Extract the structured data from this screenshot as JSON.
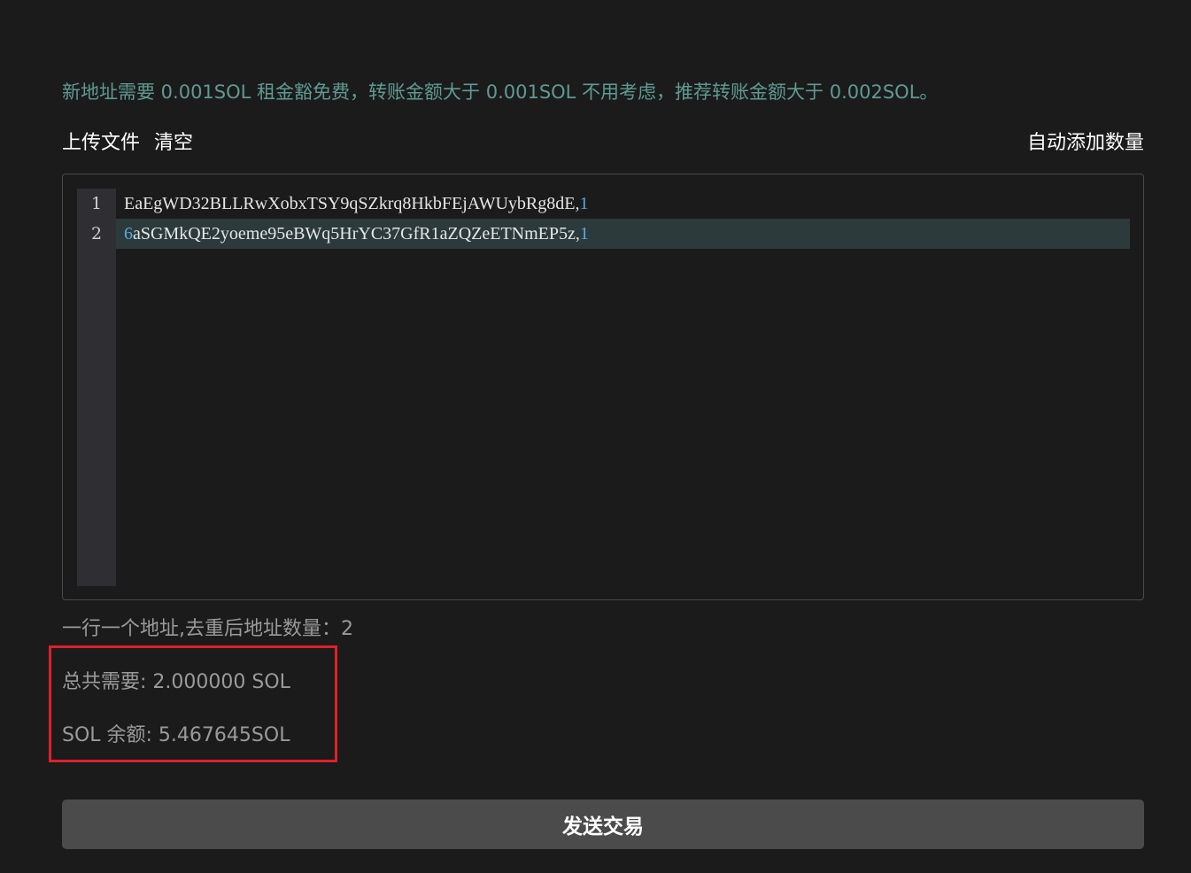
{
  "notice": "新地址需要 0.001SOL 租金豁免费，转账金额大于 0.001SOL 不用考虑，推荐转账金额大于 0.002SOL。",
  "toolbar": {
    "upload_label": "上传文件",
    "clear_label": "清空",
    "auto_add_label": "自动添加数量"
  },
  "editor": {
    "lines": [
      {
        "number": "1",
        "address": "EaEgWD32BLLRwXobxTSY9qSZkrq8HkbFEjAWUybRg8dE",
        "separator": ",",
        "amount": "1"
      },
      {
        "number": "2",
        "address_first_char": "6",
        "address": "aSGMkQE2yoeme95eBWq5HrYC37GfR1aZQZeETNmEP5z",
        "separator": ",",
        "amount": "1"
      }
    ]
  },
  "summary": {
    "count_line": "一行一个地址,去重后地址数量：2",
    "total_needed": "总共需要: 2.000000 SOL",
    "balance": "SOL 余额: 5.467645SOL"
  },
  "send_button_label": "发送交易",
  "colors": {
    "background": "#1b1b1b",
    "notice_text": "#5f9a93",
    "amount_number": "#5aa9e6",
    "highlight_border": "#e0202a",
    "button_bg": "#4b4b4b"
  }
}
